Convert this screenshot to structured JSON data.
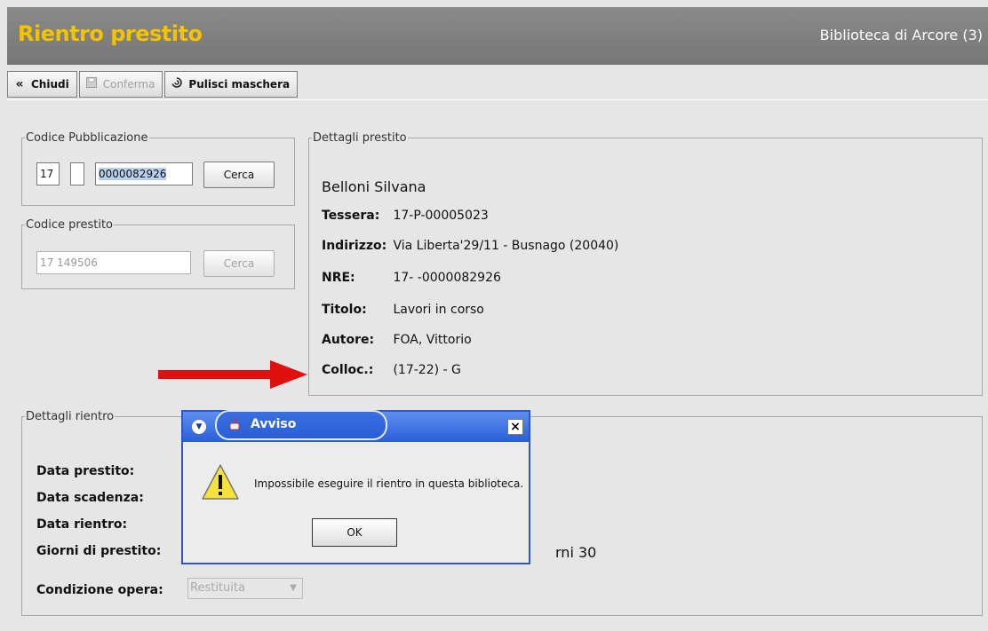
{
  "header": {
    "title": "Rientro prestito",
    "library": "Biblioteca di Arcore (3)"
  },
  "toolbar": {
    "close": "Chiudi",
    "confirm": "Conferma",
    "clear": "Pulisci maschera"
  },
  "codice_pubblicazione": {
    "legend": "Codice Pubblicazione",
    "field1": "17",
    "field2": "",
    "field3": "0000082926",
    "search": "Cerca"
  },
  "codice_prestito": {
    "legend": "Codice prestito",
    "value": "17 149506",
    "search": "Cerca"
  },
  "dettagli_prestito": {
    "legend": "Dettagli prestito",
    "name": "Belloni Silvana",
    "rows": [
      {
        "label": "Tessera:",
        "value": "17-P-00005023"
      },
      {
        "label": "Indirizzo:",
        "value": "Via Liberta'29/11 - Busnago (20040)"
      },
      {
        "label": "NRE:",
        "value": "17- -0000082926"
      },
      {
        "label": "Titolo:",
        "value": "Lavori in corso"
      },
      {
        "label": "Autore:",
        "value": "FOA, Vittorio"
      },
      {
        "label": "Colloc.:",
        "value": "(17-22) - G"
      }
    ]
  },
  "dettagli_rientro": {
    "legend": "Dettagli rientro",
    "data_prestito": "Data prestito:",
    "data_scadenza": "Data scadenza:",
    "data_rientro": "Data rientro:",
    "giorni": "Giorni di prestito:",
    "giorni_value": "rni 30",
    "condizione": "Condizione opera:",
    "condizione_value": "Restituita"
  },
  "dialog": {
    "title": "Avviso",
    "message": "Impossibile eseguire il rientro in questa biblioteca.",
    "ok": "OK"
  },
  "colors": {
    "title_yellow": "#f4c300",
    "arrow_red": "#e01010",
    "dialog_blue": "#2a5ed6"
  },
  "icons": [
    "back-icon",
    "save-icon",
    "clear-icon",
    "menu-icon",
    "java-icon",
    "close-icon",
    "warning-icon",
    "dropdown-icon",
    "red-arrow"
  ]
}
